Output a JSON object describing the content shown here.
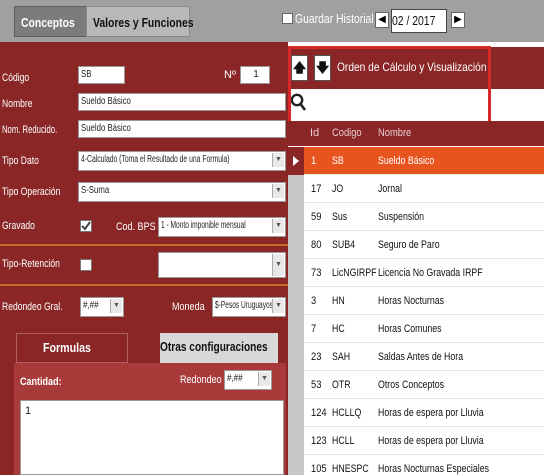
{
  "tabs": {
    "conceptos": "Conceptos",
    "valores": "Valores y Funciones"
  },
  "guardar_historial": {
    "label": "Guardar Historial",
    "checked": false
  },
  "period": {
    "value": "02 / 2017"
  },
  "form": {
    "codigo": {
      "label": "Código",
      "value": "SB"
    },
    "numero": {
      "label": "Nº",
      "value": "1"
    },
    "nombre": {
      "label": "Nombre",
      "value": "Sueldo Básico"
    },
    "nombre_reducido": {
      "label": "Nom. Reducido.",
      "value": "Sueldo Básico"
    },
    "tipo_dato": {
      "label": "Tipo Dato",
      "value": "4-Calculado (Toma el Resultado de una Formula)"
    },
    "tipo_operacion": {
      "label": "Tipo Operación",
      "value": "S-Suma"
    },
    "gravado": {
      "label": "Gravado",
      "checked": true
    },
    "cod_bps": {
      "label": "Cod. BPS",
      "value": "1 - Monto imponible mensual"
    },
    "tipo_retencion": {
      "label": "Tipo-Retención",
      "value": ""
    },
    "redondeo_gral": {
      "label": "Redondeo Gral.",
      "value": "#,##"
    },
    "moneda": {
      "label": "Moneda",
      "value": "$-Pesos Uruguayos"
    }
  },
  "subtabs": {
    "formulas": "Formulas",
    "otras": "Otras configuraciones"
  },
  "formula": {
    "cantidad_label": "Cantidad:",
    "redondeo_label": "Redondeo",
    "redondeo_value": "#,##",
    "text": "1"
  },
  "order_panel": {
    "title": "Orden de Cálculo y Visualización",
    "search_placeholder": ""
  },
  "grid": {
    "headers": {
      "id": "Id",
      "codigo": "Codigo",
      "nombre": "Nombre"
    },
    "rows": [
      {
        "id": "1",
        "codigo": "SB",
        "nombre": "Sueldo Básico",
        "selected": true
      },
      {
        "id": "17",
        "codigo": "JO",
        "nombre": "Jornal"
      },
      {
        "id": "59",
        "codigo": "Sus",
        "nombre": "Suspensión"
      },
      {
        "id": "80",
        "codigo": "SUB4",
        "nombre": "Seguro de Paro"
      },
      {
        "id": "73",
        "codigo": "LicNGIRPF",
        "nombre": "Licencia No Gravada IRPF"
      },
      {
        "id": "3",
        "codigo": "HN",
        "nombre": "Horas Nocturnas"
      },
      {
        "id": "7",
        "codigo": "HC",
        "nombre": "Horas Comunes"
      },
      {
        "id": "23",
        "codigo": "SAH",
        "nombre": "Saldas Antes de Hora"
      },
      {
        "id": "53",
        "codigo": "OTR",
        "nombre": "Otros Conceptos"
      },
      {
        "id": "124",
        "codigo": "HCLLQ",
        "nombre": "Horas de espera por Lluvia"
      },
      {
        "id": "123",
        "codigo": "HCLL",
        "nombre": "Horas de espera por Lluvia"
      },
      {
        "id": "105",
        "codigo": "HNESPC",
        "nombre": "Horas Nocturnas Especiales"
      }
    ]
  },
  "colors": {
    "primary": "#8a2626",
    "selection": "#e8541e",
    "highlight": "#d42a2a"
  }
}
